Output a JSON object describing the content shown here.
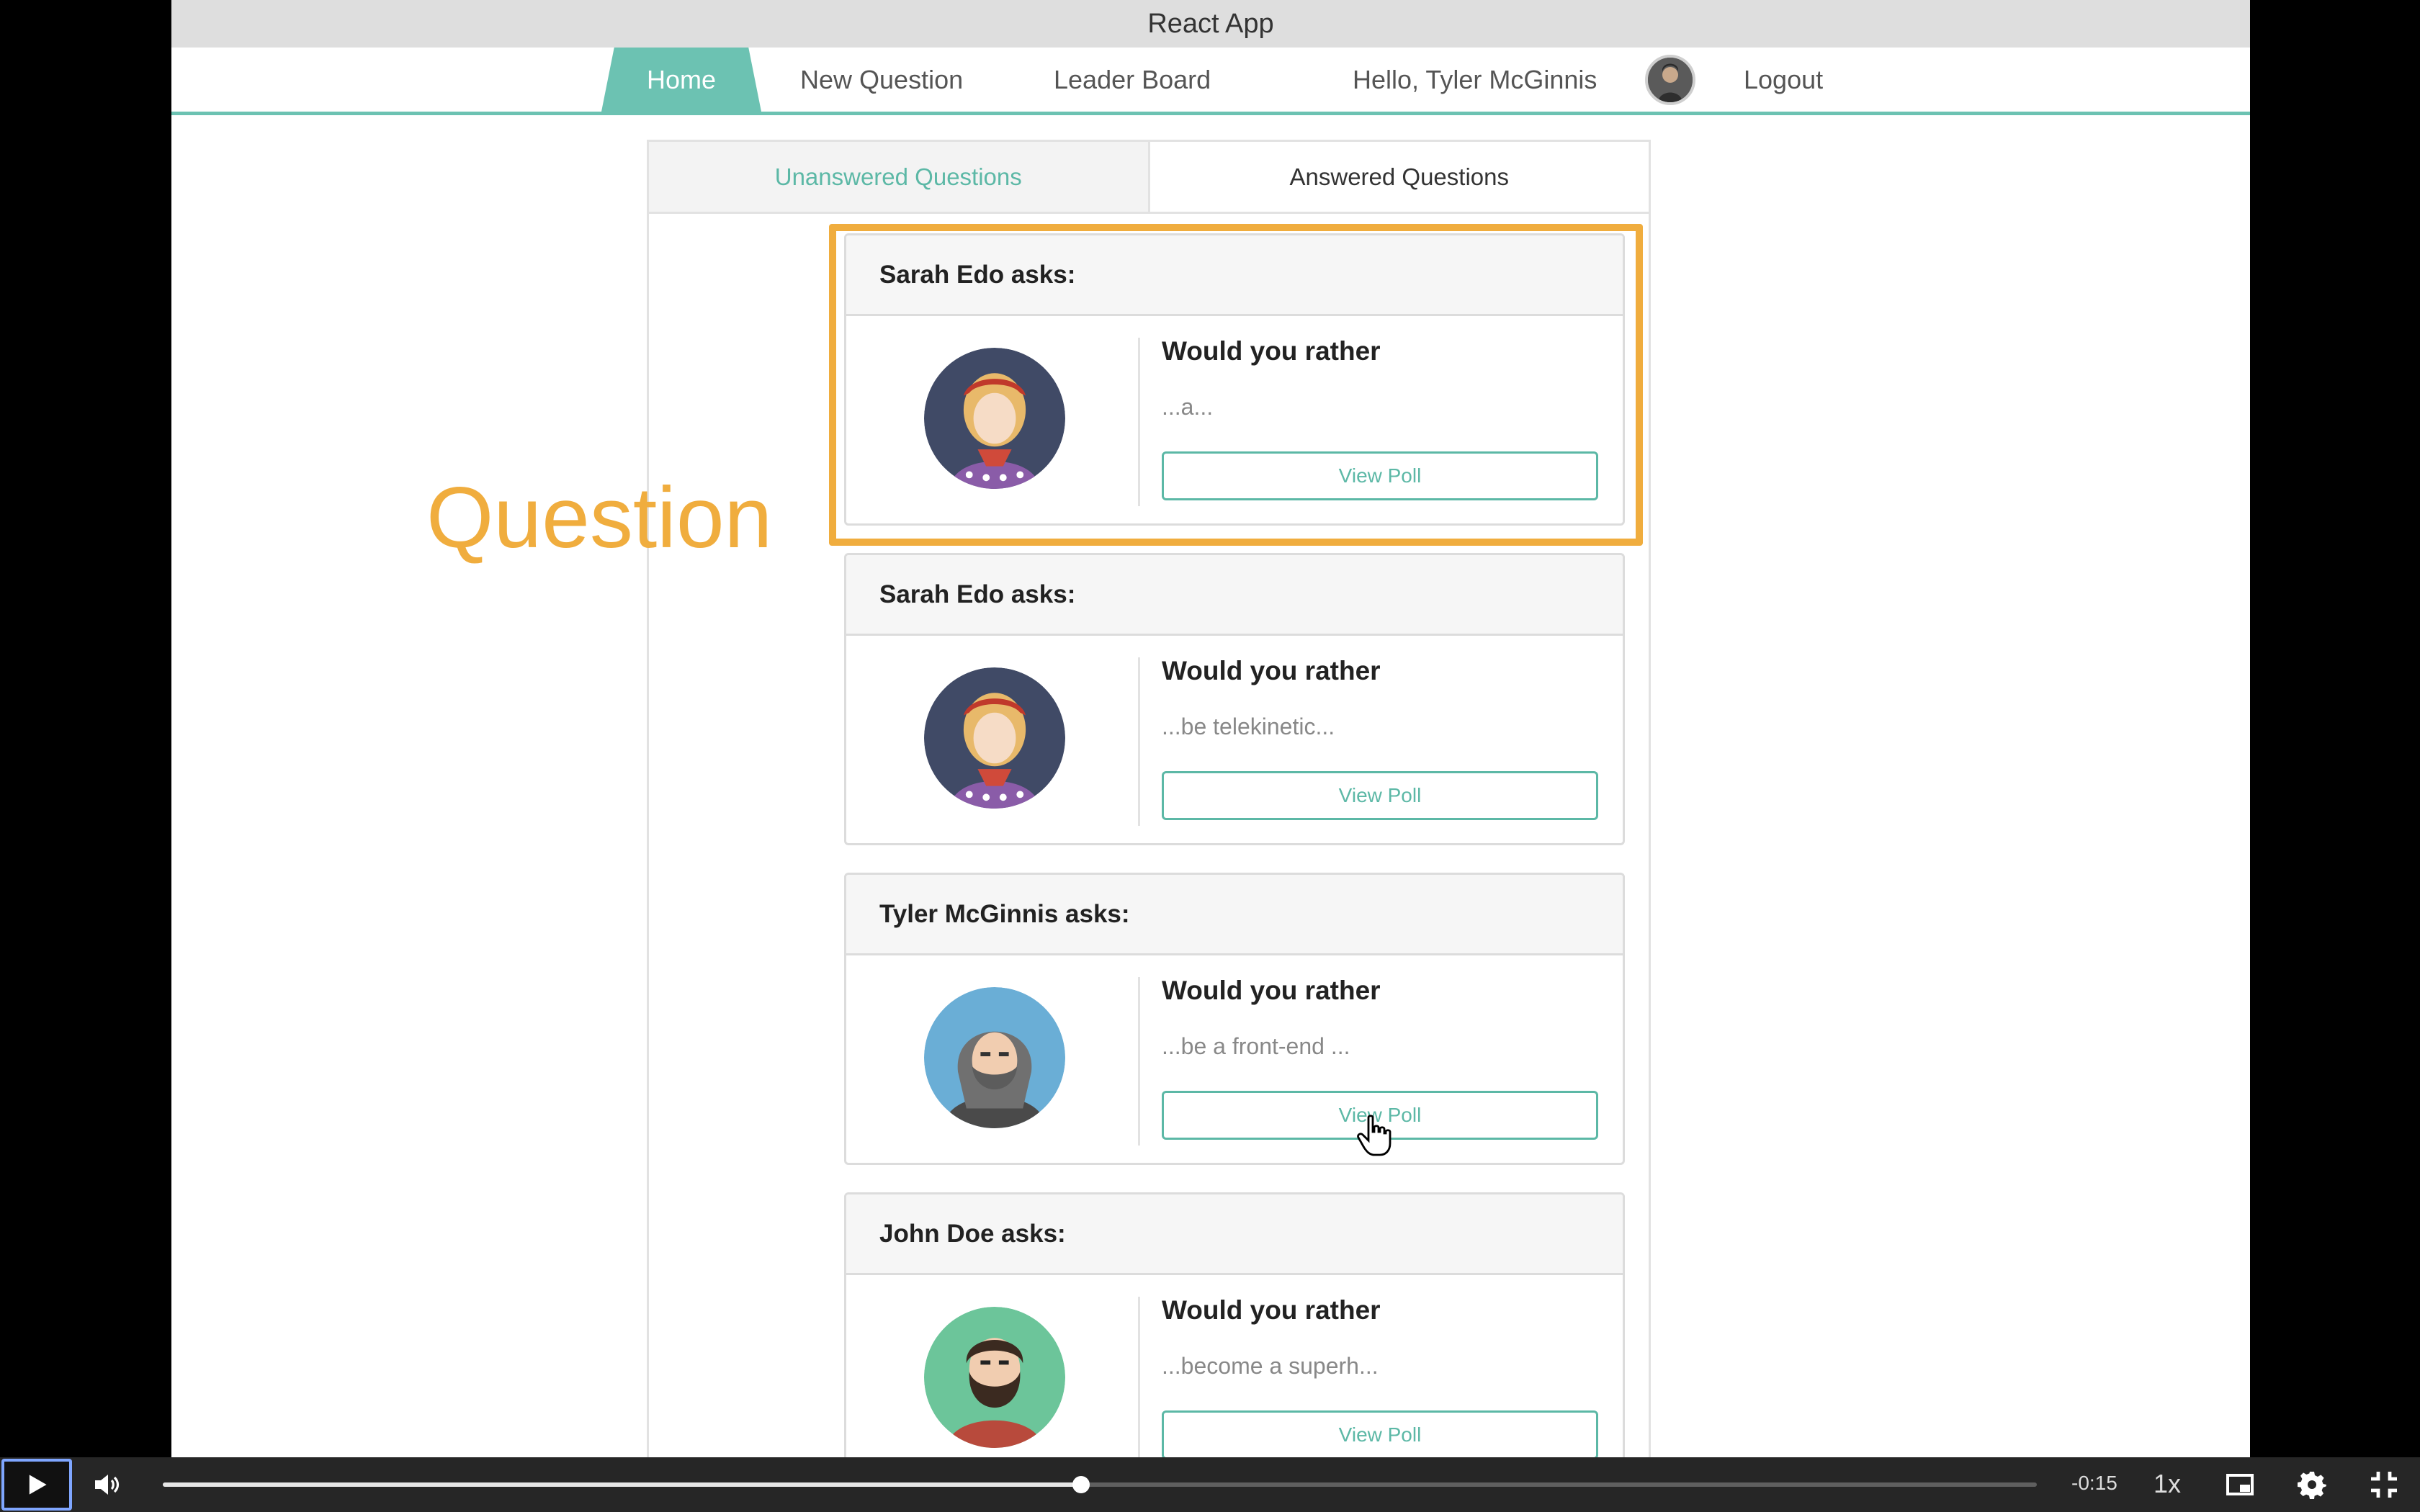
{
  "window": {
    "title": "React App"
  },
  "nav": {
    "home": "Home",
    "new_question": "New Question",
    "leader_board": "Leader Board",
    "greeting": "Hello, Tyler McGinnis",
    "logout": "Logout"
  },
  "tabs": {
    "unanswered": "Unanswered Questions",
    "answered": "Answered Questions"
  },
  "questions": [
    {
      "header": "Sarah Edo asks:",
      "prompt": "Would you rather",
      "snippet": "...a...",
      "button": "View Poll",
      "avatar": "woman-avatar"
    },
    {
      "header": "Sarah Edo asks:",
      "prompt": "Would you rather",
      "snippet": "...be telekinetic...",
      "button": "View Poll",
      "avatar": "woman-avatar"
    },
    {
      "header": "Tyler McGinnis asks:",
      "prompt": "Would you rather",
      "snippet": "...be a front-end ...",
      "button": "View Poll",
      "avatar": "hooded-man-avatar"
    },
    {
      "header": "John Doe asks:",
      "prompt": "Would you rather",
      "snippet": "...become a superh...",
      "button": "View Poll",
      "avatar": "bearded-man-avatar"
    }
  ],
  "annotation": {
    "label": "Question",
    "color": "#f0ad3e"
  },
  "accent_color": "#6cc2b2",
  "video": {
    "time_remaining": "-0:15",
    "playback_rate": "1x",
    "progress": 0.49
  }
}
